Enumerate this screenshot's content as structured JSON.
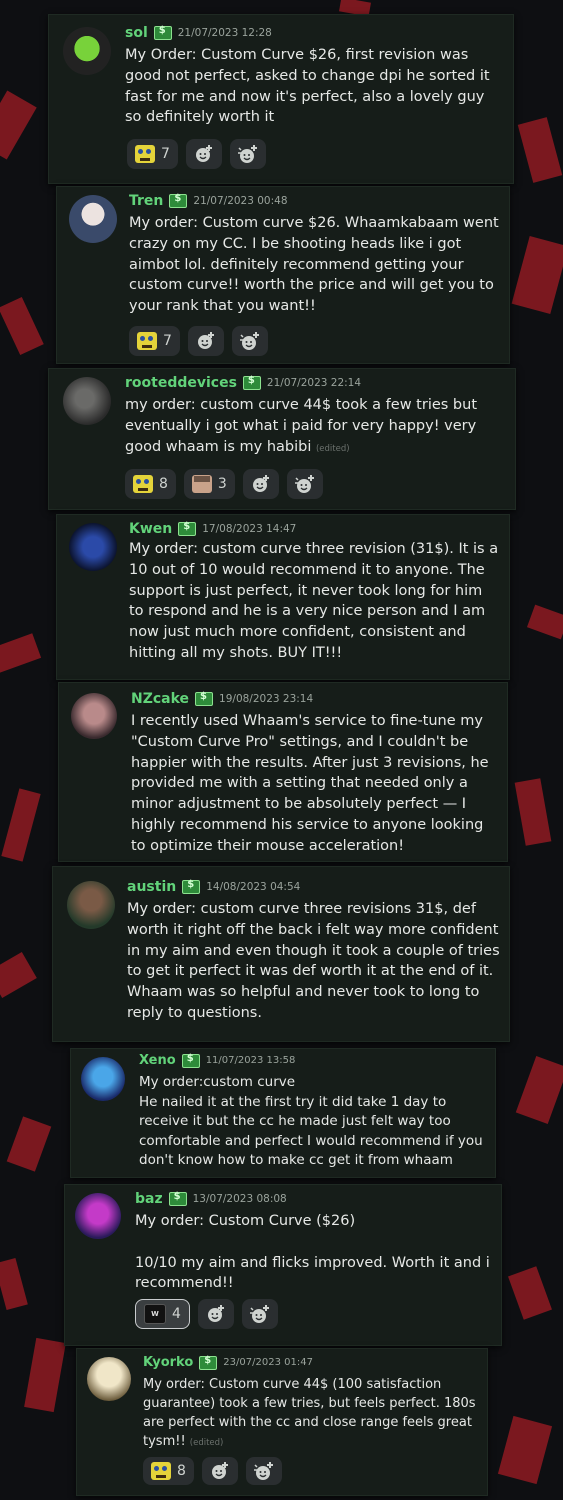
{
  "messages": [
    {
      "user": "sol",
      "time": "21/07/2023 12:28",
      "text": "My Order: Custom Curve $26, first revision was good not perfect, asked to change dpi he sorted it fast for me and now it's perfect, also a lovely guy so definitely worth it",
      "edited": "",
      "reactions": [
        {
          "count": "7"
        }
      ]
    },
    {
      "user": "Tren",
      "time": "21/07/2023 00:48",
      "text": "My order: Custom curve $26. Whaamkabaam went crazy on my CC. I be shooting heads like i got aimbot lol. definitely recommend getting your custom curve!! worth the price and will get you to your rank that you want!!",
      "edited": "",
      "reactions": [
        {
          "count": "7"
        }
      ]
    },
    {
      "user": "rooteddevices",
      "time": "21/07/2023 22:14",
      "text": "my order: custom curve 44$ took a few tries but eventually i got what i paid for very happy! very good whaam is my habibi",
      "edited": "(edited)",
      "reactions": [
        {
          "count": "8"
        },
        {
          "count": "3"
        }
      ]
    },
    {
      "user": "Kwen",
      "time": "17/08/2023 14:47",
      "text": "My order: custom curve three revision (31$). It is a 10 out of 10 would recommend it to anyone. The support is just perfect, it never took long for him to respond and he is a very nice person and I am now just much more confident, consistent and hitting all my shots. BUY IT!!!",
      "edited": "",
      "reactions": []
    },
    {
      "user": "NZcake",
      "time": "19/08/2023 23:14",
      "text": "I recently used Whaam's service to fine-tune my \"Custom Curve Pro\" settings, and I couldn't be happier with the results. After just 3 revisions, he provided me with a setting that needed only a minor adjustment to be absolutely perfect — I highly recommend his service to anyone looking to optimize their mouse acceleration!",
      "edited": "",
      "reactions": []
    },
    {
      "user": "austin",
      "time": "14/08/2023 04:54",
      "text": "My order: custom curve three revisions 31$, def worth it right off the back i felt way more confident in my aim and even though it took a couple of tries to get it perfect it was def worth it at the end of it. Whaam was so helpful and never took to long to reply to questions.",
      "edited": "",
      "reactions": []
    },
    {
      "user": "Xeno",
      "time": "11/07/2023 13:58",
      "text": "My order:custom curve\nHe nailed it at the first try it did take 1 day to receive it but the cc he made just felt way too comfortable and perfect I would recommend if you don't know how to make cc get it from whaam",
      "edited": "",
      "reactions": []
    },
    {
      "user": "baz",
      "time": "13/07/2023 08:08",
      "text": "My order: Custom Curve ($26)\n\n10/10 my aim and flicks improved. Worth it and i recommend!!",
      "edited": "",
      "reactions": [
        {
          "count": "4"
        }
      ]
    },
    {
      "user": "Kyorko",
      "time": "23/07/2023 01:47",
      "text": "My order: Custom curve 44$ (100 satisfaction guarantee) took a few tries, but feels perfect. 180s are perfect with the cc and close range feels great tysm!!",
      "edited": "(edited)",
      "reactions": [
        {
          "count": "8"
        }
      ]
    }
  ],
  "icons": {
    "reaction_1": "spongebob-emoji",
    "reaction_2": "man-face-emoji",
    "reaction_3": "w-logo-emoji",
    "add_reaction": "add-reaction-icon",
    "super_reaction": "add-super-reaction-icon",
    "badge": "money-badge-icon"
  },
  "colors": {
    "background": "#0e0f12",
    "shard": "#8e1a22",
    "card": "#161d19",
    "username": "#62d37a",
    "timestamp": "#9aa39c",
    "text": "#e6e8e6"
  }
}
